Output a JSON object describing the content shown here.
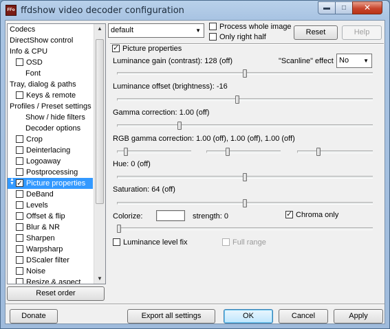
{
  "window": {
    "title": "ffdshow video decoder configuration",
    "app_icon_text": "FFo"
  },
  "preset": {
    "selected": "default",
    "process_whole_image": "Process whole image",
    "only_right_half": "Only right half",
    "reset": "Reset",
    "help": "Help"
  },
  "pages": [
    {
      "label": "Codecs",
      "check": null,
      "indent": 0
    },
    {
      "label": "DirectShow control",
      "check": null,
      "indent": 0
    },
    {
      "label": "Info & CPU",
      "check": null,
      "indent": 0
    },
    {
      "label": "OSD",
      "check": false,
      "indent": 1
    },
    {
      "label": "Font",
      "check": null,
      "indent": 2
    },
    {
      "label": "Tray, dialog & paths",
      "check": null,
      "indent": 0
    },
    {
      "label": "Keys & remote",
      "check": false,
      "indent": 1
    },
    {
      "label": "Profiles / Preset settings",
      "check": null,
      "indent": 0
    },
    {
      "label": "Show / hide filters",
      "check": null,
      "indent": 2
    },
    {
      "label": "Decoder options",
      "check": null,
      "indent": 2
    },
    {
      "label": "Crop",
      "check": false,
      "indent": 1
    },
    {
      "label": "Deinterlacing",
      "check": false,
      "indent": 1
    },
    {
      "label": "Logoaway",
      "check": false,
      "indent": 1
    },
    {
      "label": "Postprocessing",
      "check": false,
      "indent": 1
    },
    {
      "label": "Picture properties",
      "check": true,
      "indent": 1,
      "selected": true
    },
    {
      "label": "DeBand",
      "check": false,
      "indent": 1
    },
    {
      "label": "Levels",
      "check": false,
      "indent": 1
    },
    {
      "label": "Offset & flip",
      "check": false,
      "indent": 1
    },
    {
      "label": "Blur & NR",
      "check": false,
      "indent": 1
    },
    {
      "label": "Sharpen",
      "check": false,
      "indent": 1
    },
    {
      "label": "Warpsharp",
      "check": false,
      "indent": 1
    },
    {
      "label": "DScaler filter",
      "check": false,
      "indent": 1
    },
    {
      "label": "Noise",
      "check": false,
      "indent": 1
    },
    {
      "label": "Resize & aspect",
      "check": false,
      "indent": 1
    }
  ],
  "reset_order": "Reset order",
  "picture": {
    "enable_label": "Picture properties",
    "lum_gain": "Luminance gain (contrast): 128 (off)",
    "scanline_label": "\"Scanline\" effect",
    "scanline_value": "No",
    "lum_offset": "Luminance offset (brightness): -16",
    "gamma": "Gamma correction: 1.00 (off)",
    "rgb_gamma": "RGB gamma correction: 1.00 (off), 1.00 (off), 1.00 (off)",
    "hue": "Hue: 0 (off)",
    "saturation": "Saturation: 64 (off)",
    "colorize": "Colorize:",
    "strength": "strength: 0",
    "chroma_only": "Chroma only",
    "lum_level_fix": "Luminance level fix",
    "full_range": "Full range",
    "levels": {
      "lum_gain": 0.5,
      "lum_offset": 0.47,
      "gamma": 0.24,
      "rgb_r": 0.1,
      "rgb_g": 0.27,
      "rgb_b": 0.27,
      "hue": 0.5,
      "saturation": 0.5,
      "strength": 0.0
    }
  },
  "bottom": {
    "donate": "Donate",
    "export": "Export all settings",
    "ok": "OK",
    "cancel": "Cancel",
    "apply": "Apply"
  },
  "icons": {
    "minimize": "minimize-icon",
    "maximize": "maximize-icon",
    "close": "close-icon",
    "dropdown": "chevron-down-icon"
  }
}
